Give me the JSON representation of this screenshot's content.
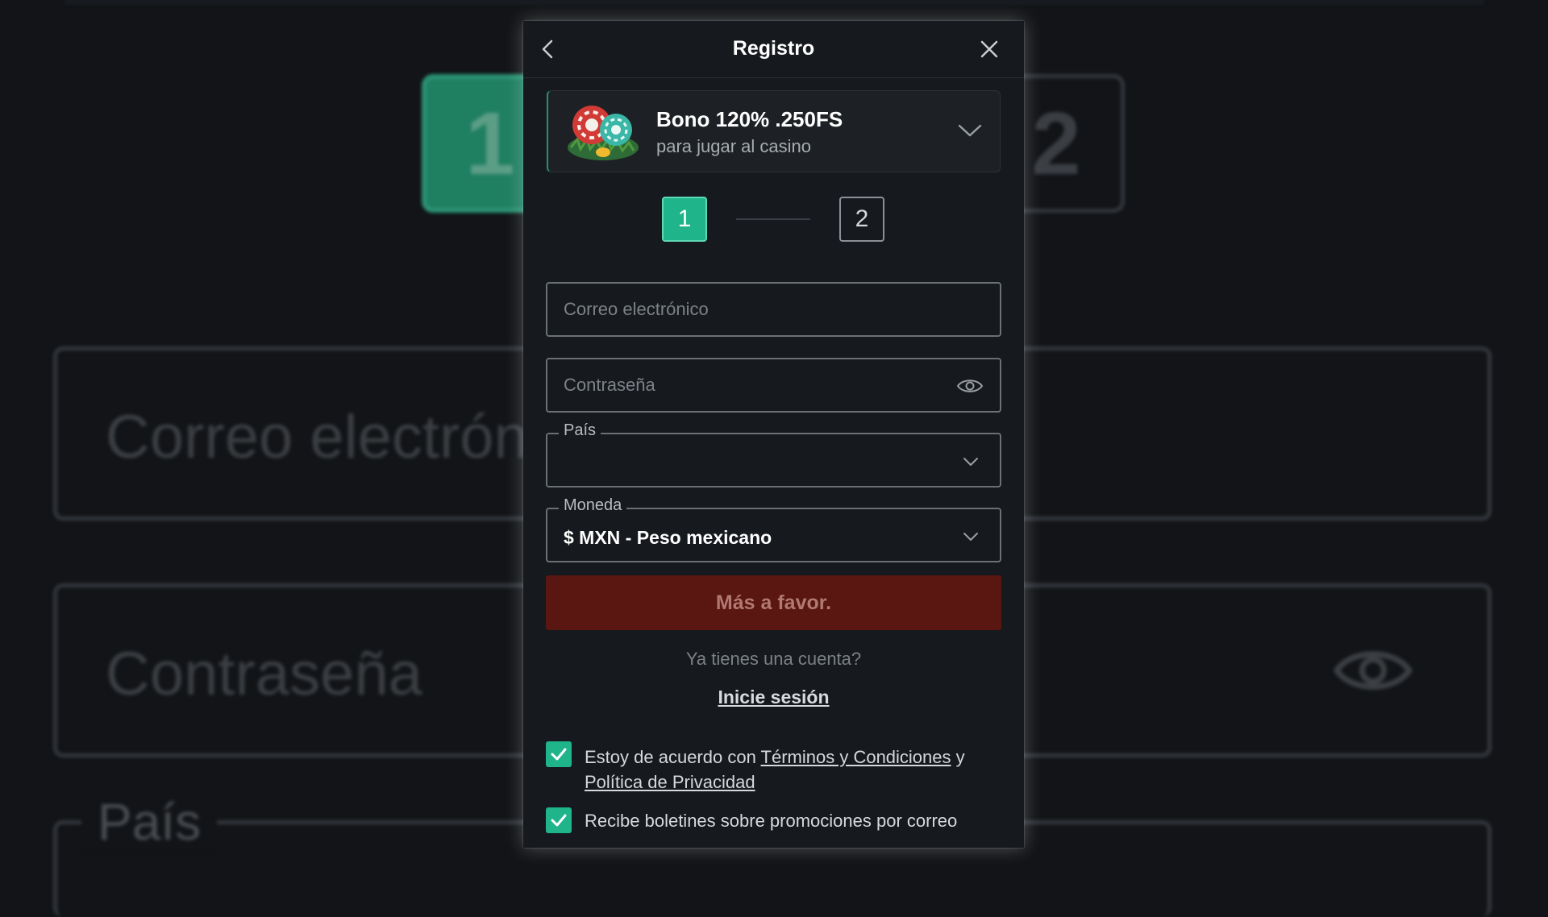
{
  "background": {
    "step1": "1",
    "step2": "2",
    "email_text": "Correo electrón",
    "password_text": "Contraseña",
    "country_text": "País"
  },
  "modal": {
    "title": "Registro",
    "bonus": {
      "title": "Bono 120% .250FS",
      "subtitle": "para jugar al casino"
    },
    "steps": {
      "step1": "1",
      "step2": "2"
    },
    "email_placeholder": "Correo electrónico",
    "password_placeholder": "Contraseña",
    "country_label": "País",
    "country_value": "",
    "currency_label": "Moneda",
    "currency_value": "$ MXN - Peso mexicano",
    "submit_label": "Más a favor.",
    "account_question": "Ya tienes una cuenta?",
    "login_link": "Inicie sesión",
    "terms": {
      "prefix": "Estoy de acuerdo con",
      "terms_link": "Términos y Condiciones",
      "conjunction": "y",
      "privacy_link": "Política de Privacidad",
      "checked": true
    },
    "newsletter": {
      "text": "Recibe boletines sobre promociones por correo",
      "checked": true
    }
  },
  "colors": {
    "accent": "#1fb48a",
    "button_bg": "#5a1610",
    "modal_bg": "#16191d"
  },
  "icons": [
    "chevron-left-icon",
    "close-icon",
    "bonus-chips-icon",
    "chevron-down-icon",
    "eye-icon",
    "check-icon"
  ]
}
